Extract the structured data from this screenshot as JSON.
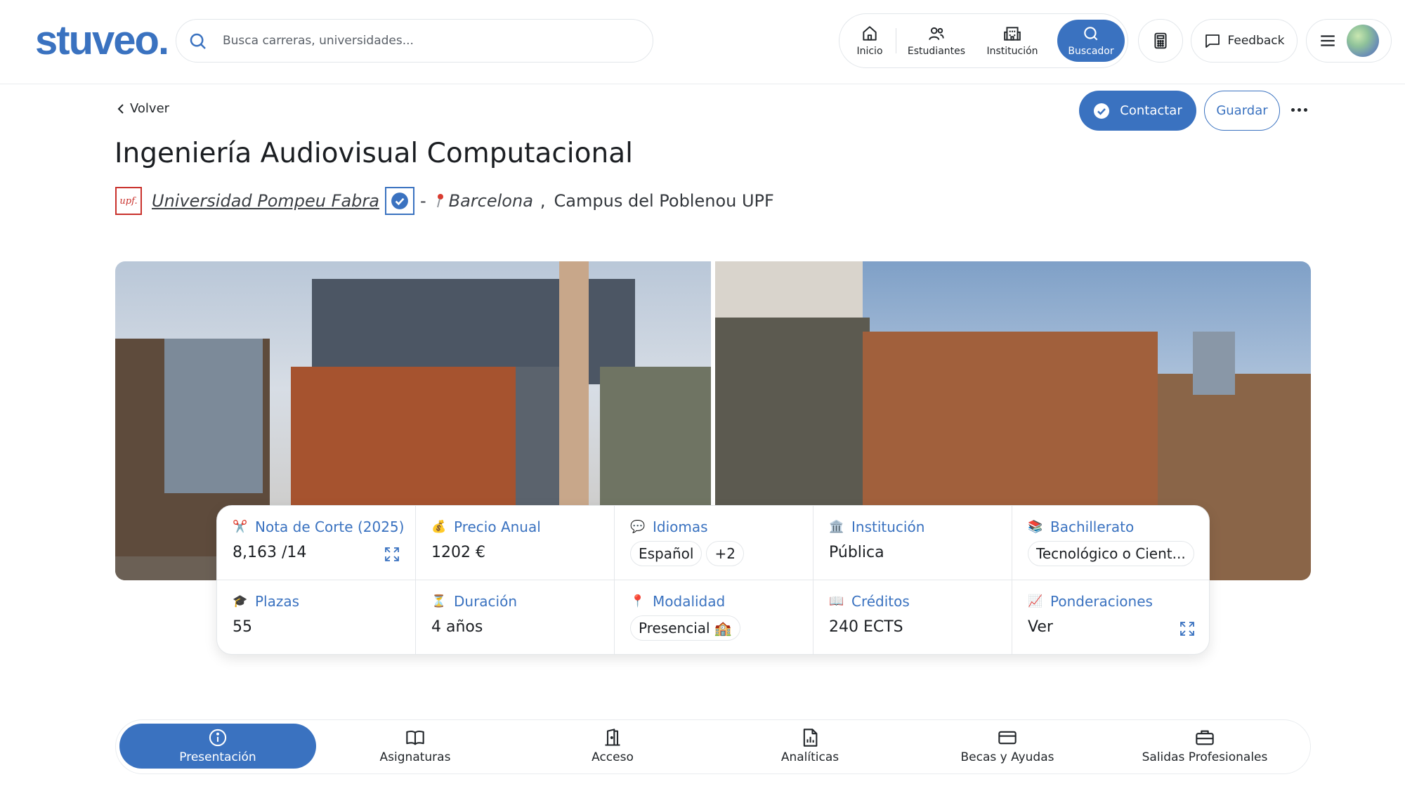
{
  "header": {
    "logo": "stuveo.",
    "search_placeholder": "Busca carreras, universidades...",
    "nav": [
      {
        "label": "Inicio",
        "icon": "home-icon"
      },
      {
        "label": "Estudiantes",
        "icon": "users-icon"
      },
      {
        "label": "Institución",
        "icon": "building-icon"
      },
      {
        "label": "Buscador",
        "icon": "search-icon",
        "active": true
      }
    ],
    "feedback_label": "Feedback"
  },
  "actions": {
    "back_label": "Volver",
    "contact_label": "Contactar",
    "save_label": "Guardar"
  },
  "program": {
    "title": "Ingeniería Audiovisual Computacional",
    "university_logo_text": "upf.",
    "university": "Universidad Pompeu Fabra",
    "separator": "-",
    "city": "Barcelona",
    "comma": ",",
    "campus": "Campus del Poblenou UPF"
  },
  "info": {
    "nota": {
      "label": "Nota de Corte (2025)",
      "value": "8,163",
      "max": "/14",
      "emoji": "✂️"
    },
    "precio": {
      "label": "Precio Anual",
      "value": "1202 €",
      "emoji": "💰"
    },
    "idiomas": {
      "label": "Idiomas",
      "value": "Español",
      "extra": "+2",
      "emoji": "💬"
    },
    "institucion": {
      "label": "Institución",
      "value": "Pública",
      "emoji": "🏛️"
    },
    "bachillerato": {
      "label": "Bachillerato",
      "value": "Tecnológico o Cient...",
      "emoji": "📚"
    },
    "plazas": {
      "label": "Plazas",
      "value": "55",
      "emoji": "🎓"
    },
    "duracion": {
      "label": "Duración",
      "value": "4 años",
      "emoji": "⏳"
    },
    "modalidad": {
      "label": "Modalidad",
      "value": "Presencial 🏫",
      "emoji": "📍"
    },
    "creditos": {
      "label": "Créditos",
      "value": "240 ECTS",
      "emoji": "📖"
    },
    "ponderaciones": {
      "label": "Ponderaciones",
      "value": "Ver",
      "emoji": "📈"
    }
  },
  "tabs": [
    {
      "label": "Presentación",
      "icon": "info-icon",
      "active": true
    },
    {
      "label": "Asignaturas",
      "icon": "book-icon"
    },
    {
      "label": "Acceso",
      "icon": "door-icon"
    },
    {
      "label": "Analíticas",
      "icon": "report-icon"
    },
    {
      "label": "Becas y Ayudas",
      "icon": "card-icon"
    },
    {
      "label": "Salidas Profesionales",
      "icon": "briefcase-icon"
    }
  ],
  "colors": {
    "accent": "#3a72c0",
    "text": "#1b1e22",
    "border": "#e4e7ea"
  }
}
